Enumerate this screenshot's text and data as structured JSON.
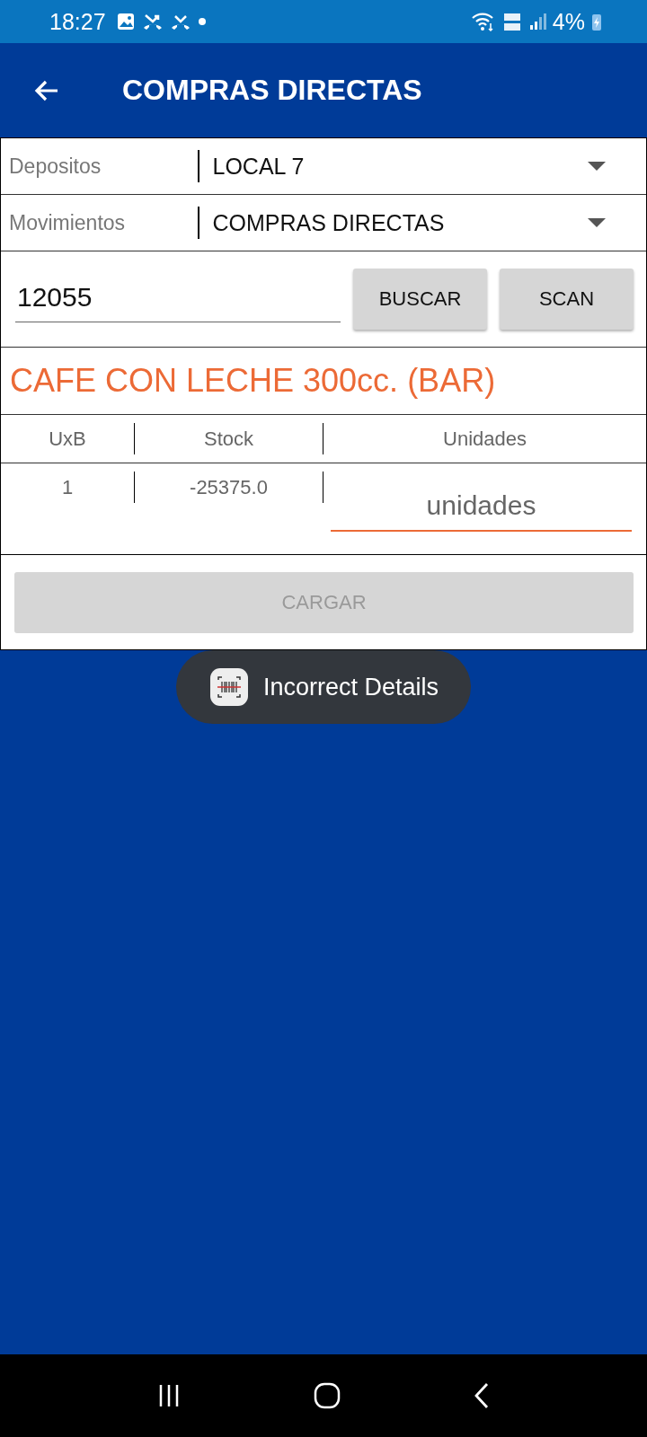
{
  "status_bar": {
    "time": "18:27",
    "battery": "4%"
  },
  "app_bar": {
    "title": "COMPRAS DIRECTAS"
  },
  "spinners": [
    {
      "label": "Depositos",
      "value": "LOCAL 7"
    },
    {
      "label": "Movimientos",
      "value": "COMPRAS DIRECTAS"
    }
  ],
  "search": {
    "value": "12055",
    "buttons": [
      "BUSCAR",
      "SCAN"
    ]
  },
  "product_name": "CAFE CON LECHE 300cc. (BAR)",
  "table": {
    "columns": [
      "UxB",
      "Stock",
      "Unidades"
    ],
    "row": [
      "1",
      "-25375.0"
    ],
    "units_field": {
      "placeholder": "unidades"
    }
  },
  "load_button": {
    "label": "CARGAR",
    "disabled": true
  },
  "toast": {
    "text": "Incorrect Details"
  }
}
